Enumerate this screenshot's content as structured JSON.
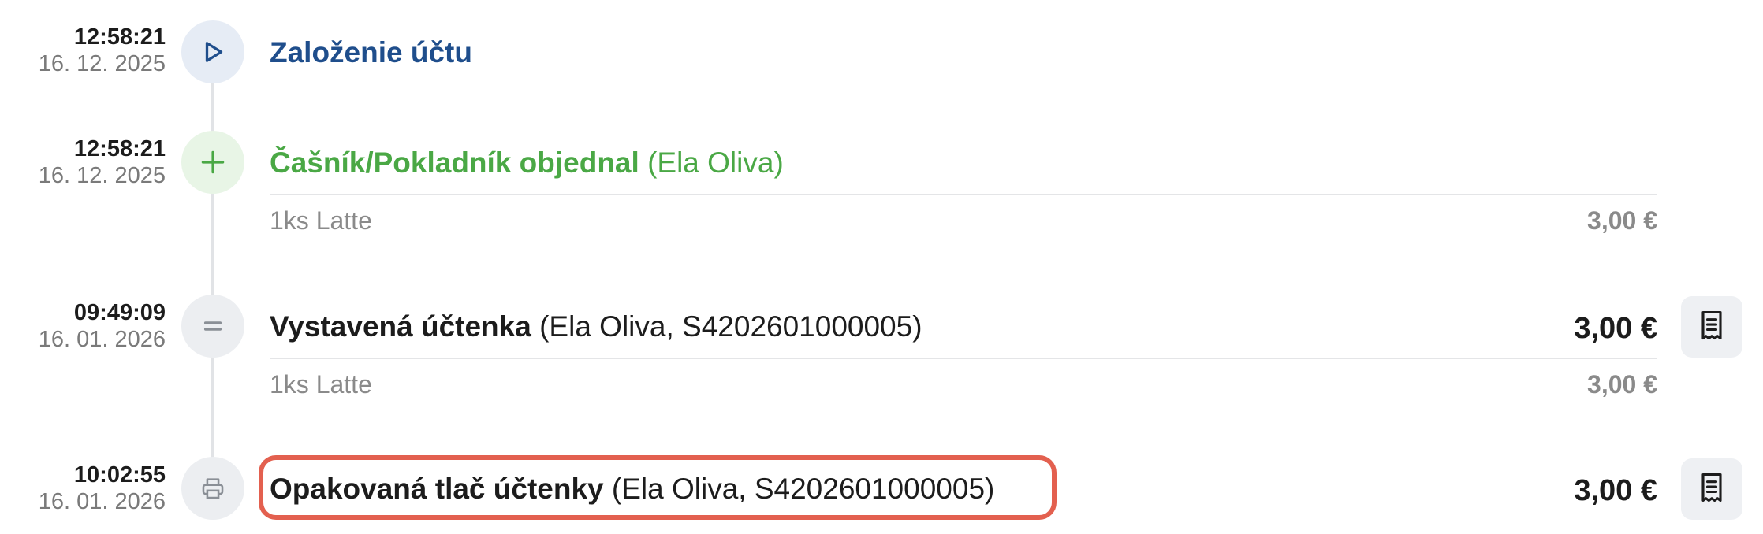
{
  "events": [
    {
      "time": "12:58:21",
      "date": "16. 12. 2025",
      "icon": "play-icon",
      "title_bold": "Založenie účtu",
      "title_rest": "",
      "color": "#1f4e8c"
    },
    {
      "time": "12:58:21",
      "date": "16. 12. 2025",
      "icon": "plus-icon",
      "title_bold": "Čašník/Pokladník objednal",
      "title_rest": " (Ela Oliva)",
      "color": "#4aa845",
      "item": {
        "label": "1ks Latte",
        "price": "3,00 €"
      }
    },
    {
      "time": "09:49:09",
      "date": "16. 01. 2026",
      "icon": "equals-icon",
      "title_bold": "Vystavená účtenka",
      "title_rest": " (Ela Oliva, S4202601000005)",
      "color": "#1c1c1c",
      "amount": "3,00 €",
      "item": {
        "label": "1ks Latte",
        "price": "3,00 €"
      }
    },
    {
      "time": "10:02:55",
      "date": "16. 01. 2026",
      "icon": "printer-icon",
      "title_bold": "Opakovaná tlač účtenky",
      "title_rest": " (Ela Oliva, S4202601000005)",
      "color": "#1c1c1c",
      "amount": "3,00 €"
    }
  ],
  "colors": {
    "highlight": "#e3604f",
    "node_blue_bg": "#e6ecf5",
    "node_green_bg": "#e8f5e6",
    "node_gray_bg": "#eceef1"
  }
}
